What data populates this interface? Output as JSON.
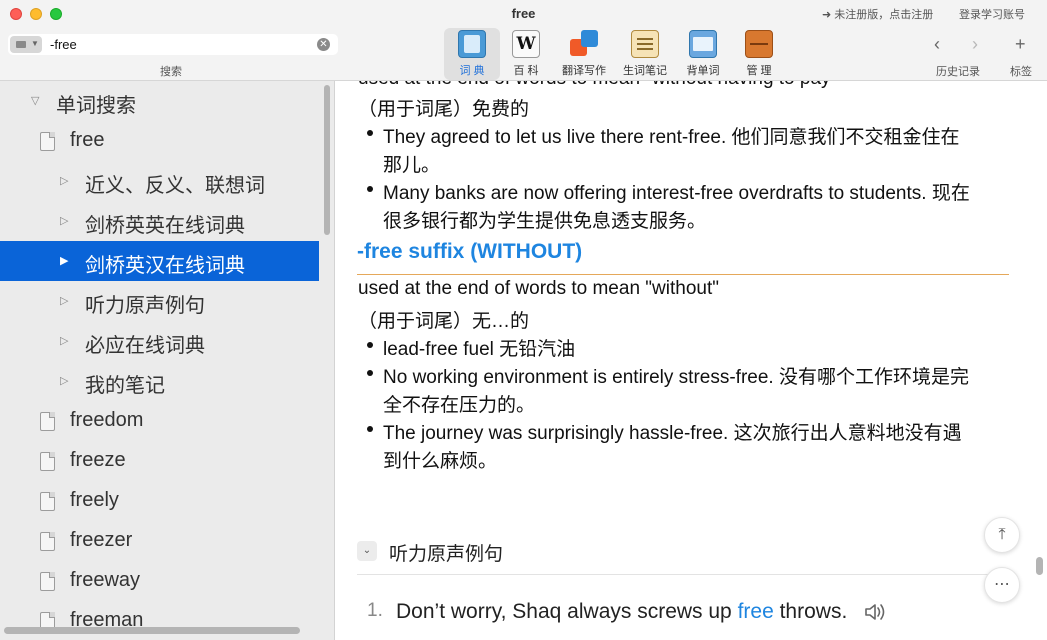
{
  "window": {
    "title": "free",
    "register_link": "➜ 未注册版，点击注册",
    "login_link": "登录学习账号"
  },
  "search": {
    "value": "-free",
    "clear_glyph": "✕",
    "caption": "搜索"
  },
  "toolbar": {
    "tools": [
      {
        "label": "词 典",
        "icon": "dictionary-book-icon",
        "icon_text": "fla"
      },
      {
        "label": "百 科",
        "icon": "wikipedia-icon",
        "icon_text": "W"
      },
      {
        "label": "翻译写作",
        "icon": "translate-icon",
        "icon_text": "汉"
      },
      {
        "label": "生词笔记",
        "icon": "word-notes-icon",
        "icon_text": ""
      },
      {
        "label": "背单词",
        "icon": "recite-book-icon",
        "icon_text": ""
      },
      {
        "label": "管 理",
        "icon": "manage-cabinet-icon",
        "icon_text": ""
      }
    ],
    "history_caption": "历史记录",
    "bookmark_caption": "标签",
    "back_glyph": "‹",
    "forward_glyph": "›",
    "add_glyph": "+"
  },
  "sidebar": {
    "root": "单词搜索",
    "items": [
      {
        "label": "free"
      },
      {
        "label": "近义、反义、联想词"
      },
      {
        "label": "剑桥英英在线词典"
      },
      {
        "label": "剑桥英汉在线词典"
      },
      {
        "label": "听力原声例句"
      },
      {
        "label": "必应在线词典"
      },
      {
        "label": "我的笔记"
      },
      {
        "label": "freedom"
      },
      {
        "label": "freeze"
      },
      {
        "label": "freely"
      },
      {
        "label": "freezer"
      },
      {
        "label": "freeway"
      },
      {
        "label": "freeman"
      }
    ]
  },
  "content": {
    "cut_top": "used at the end of words to mean \"without having to pay\"",
    "meaning1_cn": "（用于词尾）免费的",
    "examples1": [
      {
        "line1": "They agreed to let us live there rent-free. 他们同意我们不交租金住在",
        "line2": "那儿。"
      },
      {
        "line1": "Many banks are now offering interest-free overdrafts to students. 现在",
        "line2": "很多银行都为学生提供免息透支服务。"
      }
    ],
    "entry_title": "-free suffix (WITHOUT)",
    "definition_en": "used at the end of words to mean \"without\"",
    "definition_cn": "（用于词尾）无…的",
    "examples2": [
      {
        "line1": "lead-free fuel 无铅汽油",
        "line2": ""
      },
      {
        "line1": "No working environment is entirely stress-free. 没有哪个工作环境是完",
        "line2": "全不存在压力的。"
      },
      {
        "line1": "The journey was surprisingly hassle-free. 这次旅行出人意料地没有遇",
        "line2": "到什么麻烦。"
      }
    ],
    "section_title": "听力原声例句",
    "section_toggle_glyph": "⌄",
    "listening_examples": [
      {
        "number": "1.",
        "before": "Don’t worry, Shaq always screws up ",
        "highlight": "free",
        "after": " throws."
      }
    ],
    "scroll_top_glyph": "⤒",
    "more_glyph": "⋯"
  },
  "colors": {
    "accent_blue": "#1e85e0",
    "selection_blue": "#0a64d8",
    "rule_orange": "#e5a85a"
  }
}
